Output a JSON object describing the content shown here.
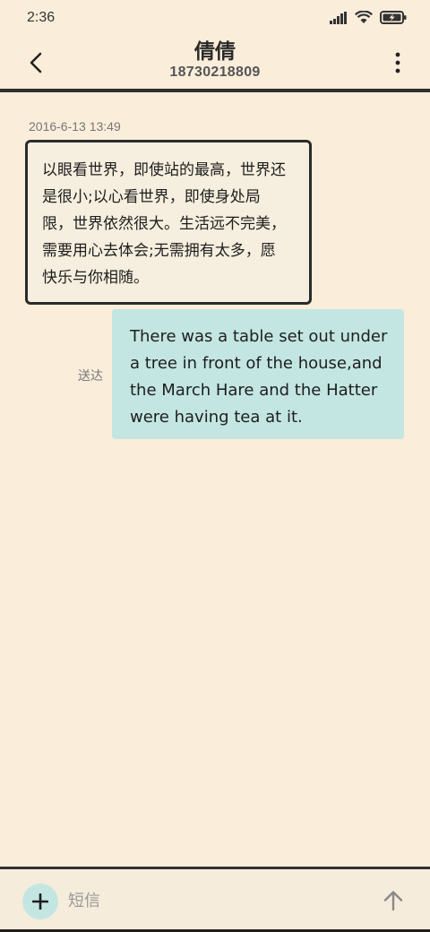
{
  "status_bar": {
    "time": "2:36",
    "icons": [
      "signal-icon",
      "wifi-icon",
      "battery-charging-icon"
    ]
  },
  "header": {
    "back_icon": "chevron-left-icon",
    "contact_name": "倩倩",
    "contact_number": "18730218809",
    "more_icon": "more-vertical-icon"
  },
  "conversation": {
    "timestamp": "2016-6-13 13:49",
    "received_message": "以眼看世界，即使站的最高，世界还是很小;以心看世界，即使身处局限，世界依然很大。生活远不完美，需要用心去体会;无需拥有太多，愿快乐与你相随。",
    "sent_message": "There was a table set out under a tree in front of the house,and the March Hare and the Hatter were having tea at it.",
    "sent_status": "送达"
  },
  "composer": {
    "add_icon": "plus-icon",
    "placeholder": "短信",
    "value": "",
    "send_icon": "arrow-up-icon"
  },
  "colors": {
    "background": "#faeedb",
    "sent_bubble": "#c3e6e2",
    "received_bubble_border": "#2b2b2b"
  }
}
